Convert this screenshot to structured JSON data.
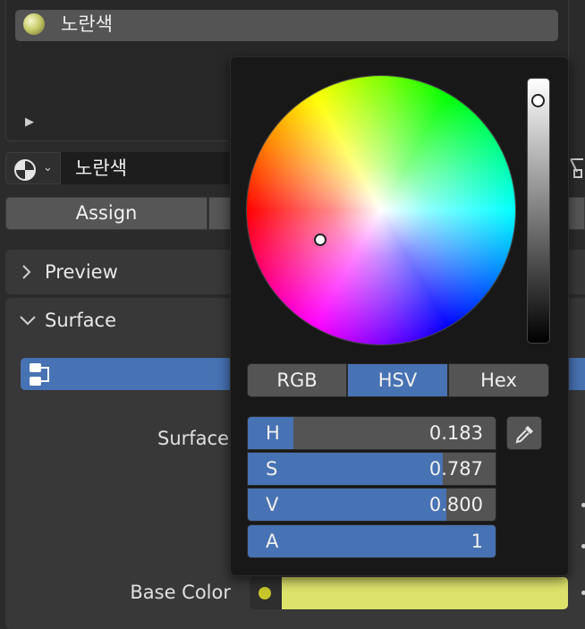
{
  "material_slots": {
    "items": [
      {
        "name": "노란색"
      }
    ],
    "expand_icon": "triangle-right-icon"
  },
  "material_selector": {
    "type_icon": "material-sphere-icon",
    "name": "노란색"
  },
  "buttons": {
    "assign": "Assign"
  },
  "panels": {
    "preview": {
      "title": "Preview",
      "expanded": false
    },
    "surface": {
      "title": "Surface",
      "expanded": true
    }
  },
  "properties": {
    "surface_label": "Surface",
    "base_color_label": "Base Color",
    "base_color_hex": "#dde36a",
    "accent": "#4772b3"
  },
  "color_picker": {
    "modes": [
      "RGB",
      "HSV",
      "Hex"
    ],
    "active_mode": "HSV",
    "fields": {
      "h": {
        "label": "H",
        "value": "0.183",
        "fraction": 0.183
      },
      "s": {
        "label": "S",
        "value": "0.787",
        "fraction": 0.787
      },
      "v": {
        "label": "V",
        "value": "0.800",
        "fraction": 0.8
      },
      "a": {
        "label": "A",
        "value": "1",
        "fraction": 1.0
      }
    },
    "eyedropper_icon": "eyedropper-icon"
  }
}
